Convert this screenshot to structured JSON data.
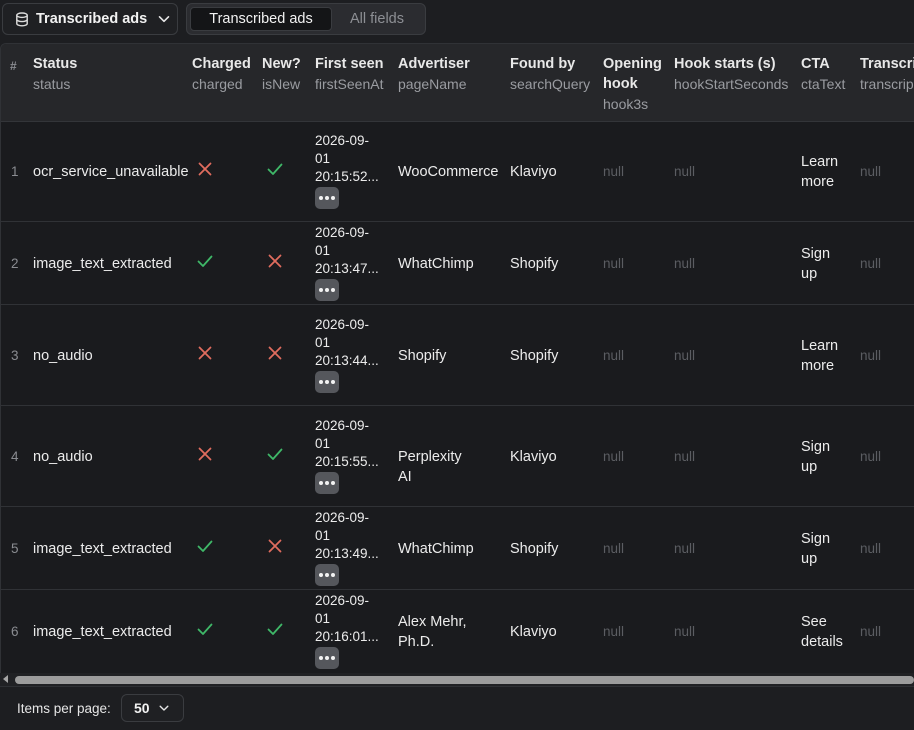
{
  "toolbar": {
    "view_select_label": "Transcribed ads",
    "tabs": [
      {
        "label": "Transcribed ads",
        "active": true
      },
      {
        "label": "All fields",
        "active": false
      }
    ]
  },
  "table": {
    "index_header": "#",
    "columns": [
      {
        "key": "status",
        "label": "Status",
        "sub": "status"
      },
      {
        "key": "charged",
        "label": "Charged",
        "sub": "charged"
      },
      {
        "key": "isNew",
        "label": "New?",
        "sub": "isNew"
      },
      {
        "key": "firstSeenAt",
        "label": "First seen",
        "sub": "firstSeenAt"
      },
      {
        "key": "pageName",
        "label": "Advertiser",
        "sub": "pageName"
      },
      {
        "key": "searchQuery",
        "label": "Found by",
        "sub": "searchQuery"
      },
      {
        "key": "hook3s",
        "label_line1": "Opening",
        "label_line2": "hook",
        "sub": "hook3s"
      },
      {
        "key": "hookStartSeconds",
        "label": "Hook starts (s)",
        "sub": "hookStartSeconds"
      },
      {
        "key": "ctaText",
        "label": "CTA",
        "sub": "ctaText"
      },
      {
        "key": "transcript",
        "label": "Transcrip",
        "sub": "transcrip"
      }
    ],
    "rows": [
      {
        "index": "1",
        "status": "ocr_service_unavailable",
        "charged": false,
        "isNew": true,
        "firstSeen": [
          "2026-09-",
          "01",
          "20:15:52..."
        ],
        "advertiser": "WooCommerce",
        "foundBy": "Klaviyo",
        "hook3s": "null",
        "hookStart": "null",
        "cta": "Learn more",
        "transcript": "null"
      },
      {
        "index": "2",
        "status": "image_text_extracted",
        "charged": true,
        "isNew": false,
        "firstSeen": [
          "2026-09-",
          "01",
          "20:13:47..."
        ],
        "advertiser": "WhatChimp",
        "foundBy": "Shopify",
        "hook3s": "null",
        "hookStart": "null",
        "cta": "Sign up",
        "transcript": "null"
      },
      {
        "index": "3",
        "status": "no_audio",
        "charged": false,
        "isNew": false,
        "firstSeen": [
          "2026-09-",
          "01",
          "20:13:44..."
        ],
        "advertiser": "Shopify",
        "foundBy": "Shopify",
        "hook3s": "null",
        "hookStart": "null",
        "cta": "Learn more",
        "transcript": "null"
      },
      {
        "index": "4",
        "status": "no_audio",
        "charged": false,
        "isNew": true,
        "firstSeen": [
          "2026-09-",
          "01",
          "20:15:55..."
        ],
        "advertiser": "Perplexity AI",
        "foundBy": "Klaviyo",
        "hook3s": "null",
        "hookStart": "null",
        "cta": "Sign up",
        "transcript": "null"
      },
      {
        "index": "5",
        "status": "image_text_extracted",
        "charged": true,
        "isNew": false,
        "firstSeen": [
          "2026-09-",
          "01",
          "20:13:49..."
        ],
        "advertiser": "WhatChimp",
        "foundBy": "Shopify",
        "hook3s": "null",
        "hookStart": "null",
        "cta": "Sign up",
        "transcript": "null"
      },
      {
        "index": "6",
        "status": "image_text_extracted",
        "charged": true,
        "isNew": true,
        "firstSeen": [
          "2026-09-",
          "01",
          "20:16:01..."
        ],
        "advertiser": "Alex Mehr, Ph.D.",
        "foundBy": "Klaviyo",
        "hook3s": "null",
        "hookStart": "null",
        "cta": "See details",
        "transcript": "null"
      }
    ]
  },
  "footer": {
    "items_per_page_label": "Items per page:",
    "items_per_page_value": "50"
  },
  "colors": {
    "check": "#3fb868",
    "cross": "#e06c5e",
    "null_text": "#5b5d62"
  },
  "icons": {
    "view_select": "database-icon",
    "dropdown": "chevron-down-icon",
    "charged_true": "check-icon",
    "charged_false": "x-icon",
    "row_more": "ellipsis-icon"
  }
}
